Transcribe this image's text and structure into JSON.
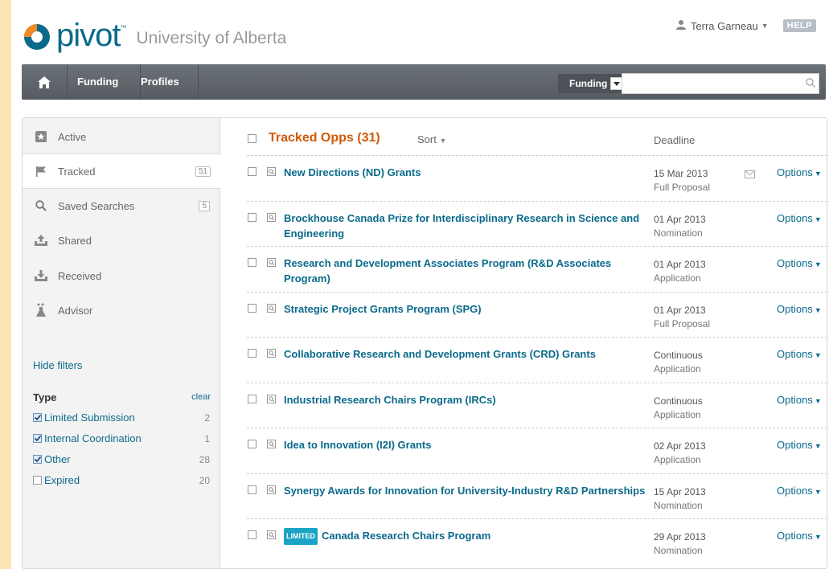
{
  "header": {
    "logo_text": "pivot",
    "institution": "University of Alberta",
    "user_name": "Terra Garneau",
    "help_label": "HELP"
  },
  "nav": {
    "home_icon": "home-icon",
    "items": [
      "Funding",
      "Profiles"
    ],
    "search_scope": "Funding",
    "search_value": ""
  },
  "sidebar": {
    "items": [
      {
        "label": "Active",
        "icon": "star-icon"
      },
      {
        "label": "Tracked",
        "icon": "flag-icon",
        "count": "51"
      },
      {
        "label": "Saved Searches",
        "icon": "search-icon",
        "count": "5"
      },
      {
        "label": "Shared",
        "icon": "share-icon"
      },
      {
        "label": "Received",
        "icon": "inbox-icon"
      },
      {
        "label": "Advisor",
        "icon": "advisor-icon"
      }
    ],
    "hide_filters": "Hide filters",
    "type_label": "Type",
    "clear_label": "clear",
    "filters": [
      {
        "label": "Limited Submission",
        "count": "2",
        "checked": true
      },
      {
        "label": "Internal Coordination",
        "count": "1",
        "checked": true
      },
      {
        "label": "Other",
        "count": "28",
        "checked": true
      },
      {
        "label": "Expired",
        "count": "20",
        "checked": false
      }
    ]
  },
  "list": {
    "title": "Tracked Opps (31)",
    "sort_label": "Sort",
    "deadline_header": "Deadline",
    "options_label": "Options",
    "limited_badge": "LIMITED",
    "rows": [
      {
        "title": "New Directions (ND) Grants",
        "date": "15 Mar 2013",
        "type": "Full Proposal",
        "envelope": true
      },
      {
        "title": "Brockhouse Canada Prize for Interdisciplinary Research in Science and Engineering",
        "date": "01 Apr 2013",
        "type": "Nomination"
      },
      {
        "title": "Research and Development Associates Program (R&D Associates Program)",
        "date": "01 Apr 2013",
        "type": "Application"
      },
      {
        "title": "Strategic Project Grants Program (SPG)",
        "date": "01 Apr 2013",
        "type": "Full Proposal"
      },
      {
        "title": "Collaborative Research and Development Grants (CRD) Grants",
        "date": "Continuous",
        "type": "Application"
      },
      {
        "title": "Industrial Research Chairs Program (IRCs)",
        "date": "Continuous",
        "type": "Application"
      },
      {
        "title": "Idea to Innovation (I2I) Grants",
        "date": "02 Apr 2013",
        "type": "Application"
      },
      {
        "title": "Synergy Awards for Innovation for University-Industry R&D Partnerships",
        "date": "15 Apr 2013",
        "type": "Nomination"
      },
      {
        "title": "Canada Research Chairs Program",
        "date": "29 Apr 2013",
        "type": "Nomination",
        "limited": true
      }
    ]
  },
  "colors": {
    "accent": "#0b6a8b",
    "title_orange": "#d05a06",
    "nav_bg": "#5f656b",
    "page_edge": "#fbe4b2"
  }
}
